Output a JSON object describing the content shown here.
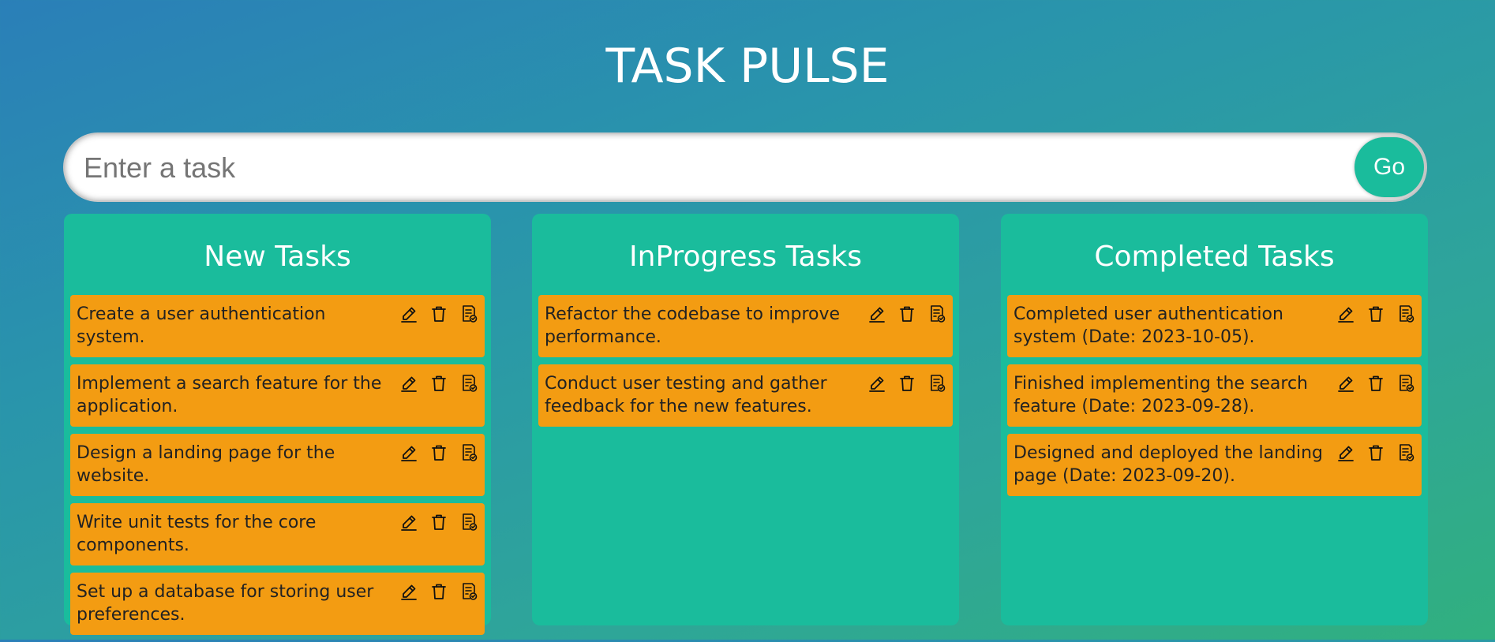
{
  "app": {
    "title": "TASK PULSE"
  },
  "form": {
    "placeholder": "Enter a task",
    "button_label": "Go"
  },
  "columns": [
    {
      "title": "New Tasks",
      "tasks": [
        "Create a user authentication system.",
        "Implement a search feature for the application.",
        "Design a landing page for the website.",
        "Write unit tests for the core components.",
        "Set up a database for storing user preferences."
      ]
    },
    {
      "title": "InProgress Tasks",
      "tasks": [
        "Refactor the codebase to improve performance.",
        "Conduct user testing and gather feedback for the new features."
      ]
    },
    {
      "title": "Completed Tasks",
      "tasks": [
        "Completed user authentication system (Date: 2023-10-05).",
        "Finished implementing the search feature (Date: 2023-09-28).",
        "Designed and deployed the landing page (Date: 2023-09-20)."
      ]
    }
  ],
  "icons": {
    "edit": "pencil-icon",
    "delete": "trash-icon",
    "move": "document-check-icon"
  },
  "colors": {
    "accent": "#1abc9c",
    "task_card": "#f39c12"
  }
}
